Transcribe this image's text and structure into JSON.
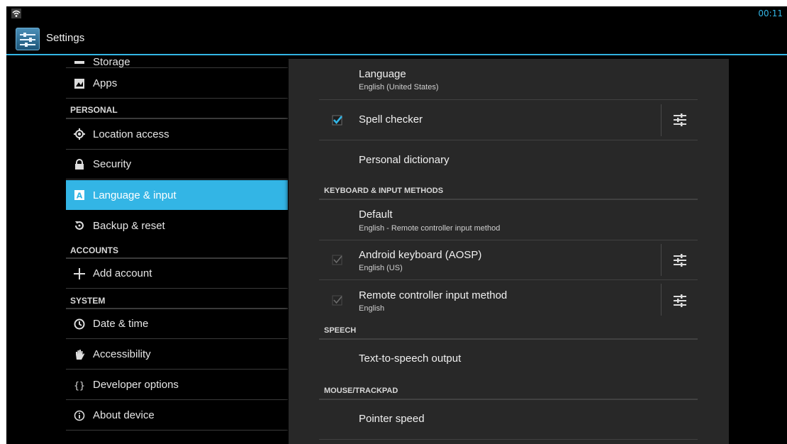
{
  "status_bar": {
    "time": "00:11",
    "wifi_icon": "wifi-icon"
  },
  "action_bar": {
    "title": "Settings",
    "app_icon": "settings-icon"
  },
  "colors": {
    "accent": "#33b5e5",
    "panel": "#282828",
    "background": "#000000"
  },
  "sidebar": {
    "partial_item": "Storage",
    "items": [
      {
        "label": "Apps",
        "icon": "apps-icon"
      },
      {
        "header": "PERSONAL"
      },
      {
        "label": "Location access",
        "icon": "location-icon"
      },
      {
        "label": "Security",
        "icon": "lock-icon"
      },
      {
        "label": "Language & input",
        "icon": "language-icon",
        "selected": true
      },
      {
        "label": "Backup & reset",
        "icon": "backup-icon"
      },
      {
        "header": "ACCOUNTS"
      },
      {
        "label": "Add account",
        "icon": "plus-icon"
      },
      {
        "header": "SYSTEM"
      },
      {
        "label": "Date & time",
        "icon": "clock-icon"
      },
      {
        "label": "Accessibility",
        "icon": "hand-icon"
      },
      {
        "label": "Developer options",
        "icon": "braces-icon"
      },
      {
        "label": "About device",
        "icon": "info-icon"
      }
    ]
  },
  "main": {
    "language": {
      "title": "Language",
      "summary": "English (United States)"
    },
    "spell_checker": {
      "title": "Spell checker",
      "checked": true
    },
    "personal_dictionary": {
      "title": "Personal dictionary"
    },
    "keyboard_header": "KEYBOARD & INPUT METHODS",
    "default": {
      "title": "Default",
      "summary": "English - Remote controller input method"
    },
    "android_keyboard": {
      "title": "Android keyboard (AOSP)",
      "summary": "English (US)",
      "checked": true,
      "enabled": false
    },
    "remote_input": {
      "title": "Remote controller input method",
      "summary": "English",
      "checked": true,
      "enabled": false
    },
    "speech_header": "SPEECH",
    "tts": {
      "title": "Text-to-speech output"
    },
    "mouse_header": "MOUSE/TRACKPAD",
    "pointer_speed": {
      "title": "Pointer speed"
    }
  }
}
